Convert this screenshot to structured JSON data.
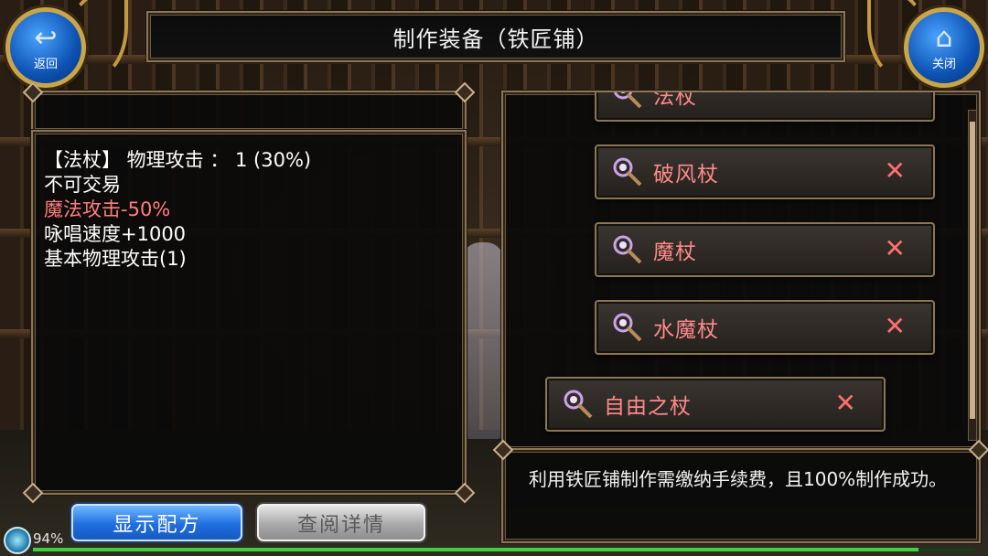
{
  "header": {
    "title": "制作装备（铁匠铺）",
    "back_label": "返回",
    "close_label": "关闭"
  },
  "item_detail": {
    "lines": [
      {
        "text": "【法杖】 物理攻击 ：  1 (30%)",
        "color": "#ffffff"
      },
      {
        "text": "不可交易",
        "color": "#ffffff"
      },
      {
        "text": "魔法攻击-50%",
        "color": "#ff7d7d"
      },
      {
        "text": "咏唱速度+1000",
        "color": "#ffffff"
      },
      {
        "text": "基本物理攻击(1)",
        "color": "#ffffff"
      }
    ]
  },
  "buttons": {
    "show_recipe": "显示配方",
    "view_details": "查阅详情"
  },
  "status": {
    "percent_label": "94%",
    "bar_fill_fraction": 0.94
  },
  "recipe_list": {
    "items": [
      {
        "name": "法杖",
        "status": "selected",
        "icon": "staff-icon"
      },
      {
        "name": "破风杖",
        "status": "unavailable",
        "icon": "staff-icon"
      },
      {
        "name": "魔杖",
        "status": "unavailable",
        "icon": "staff-icon"
      },
      {
        "name": "水魔杖",
        "status": "unavailable",
        "icon": "staff-icon"
      },
      {
        "name": "自由之杖",
        "status": "unavailable",
        "icon": "staff-icon"
      }
    ],
    "unavailable_mark": "✕"
  },
  "description": {
    "text": "利用铁匠铺制作需缴纳手续费，且100%制作成功。"
  },
  "colors": {
    "accent_red": "#ff7d7d",
    "button_blue": "#1f6fe0",
    "frame_gold": "#8c7655"
  }
}
